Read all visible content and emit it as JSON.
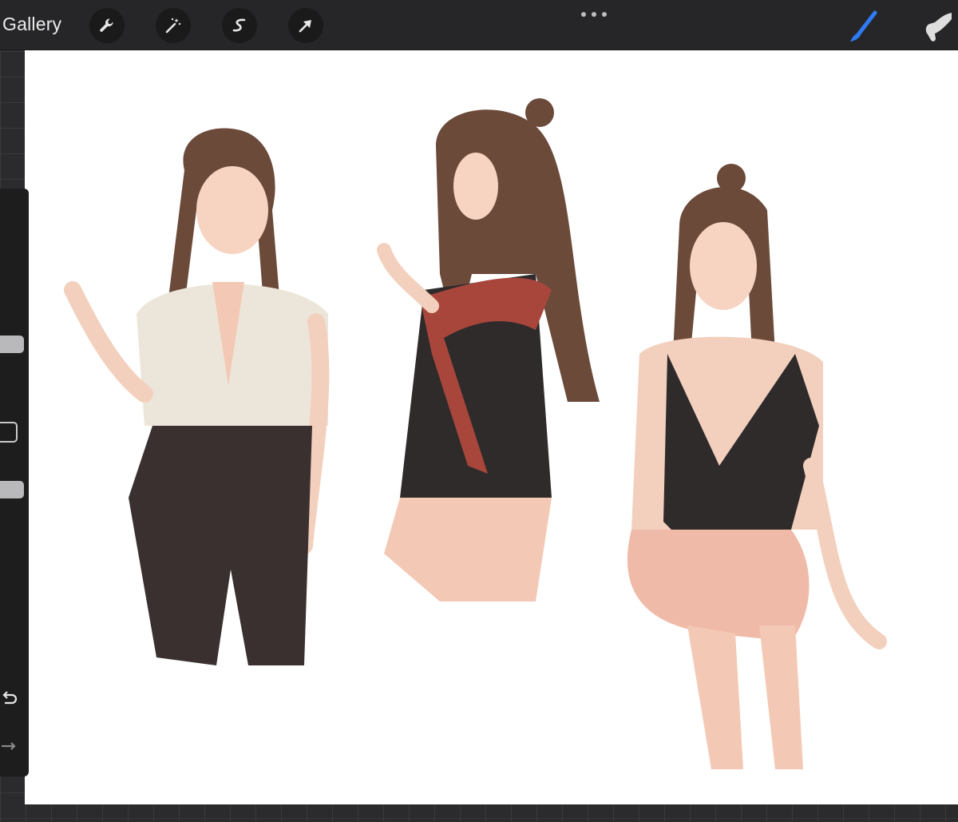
{
  "topbar": {
    "gallery_label": "Gallery",
    "tools": [
      {
        "icon": "wrench-icon",
        "name": "actions"
      },
      {
        "icon": "magic-wand-icon",
        "name": "adjustments"
      },
      {
        "icon": "s-selection-icon",
        "name": "selection"
      },
      {
        "icon": "arrow-cursor-icon",
        "name": "transform"
      }
    ],
    "more_icon": "ellipsis-icon",
    "right_tools": [
      {
        "icon": "brush-icon",
        "name": "paint",
        "active": true
      },
      {
        "icon": "smudge-finger-icon",
        "name": "smudge"
      }
    ]
  },
  "canvas": {
    "content": "artwork",
    "figures": [
      "figure-1",
      "figure-2",
      "figure-3"
    ]
  },
  "sidebar": {
    "controls": [
      "brush-size-slider",
      "modify-button",
      "opacity-slider",
      "undo-icon",
      "redo-icon"
    ]
  },
  "colors": {
    "background": "#2b2b2d",
    "toolbar": "#262628",
    "accent_blue": "#2f7bf5",
    "canvas": "#ffffff"
  }
}
